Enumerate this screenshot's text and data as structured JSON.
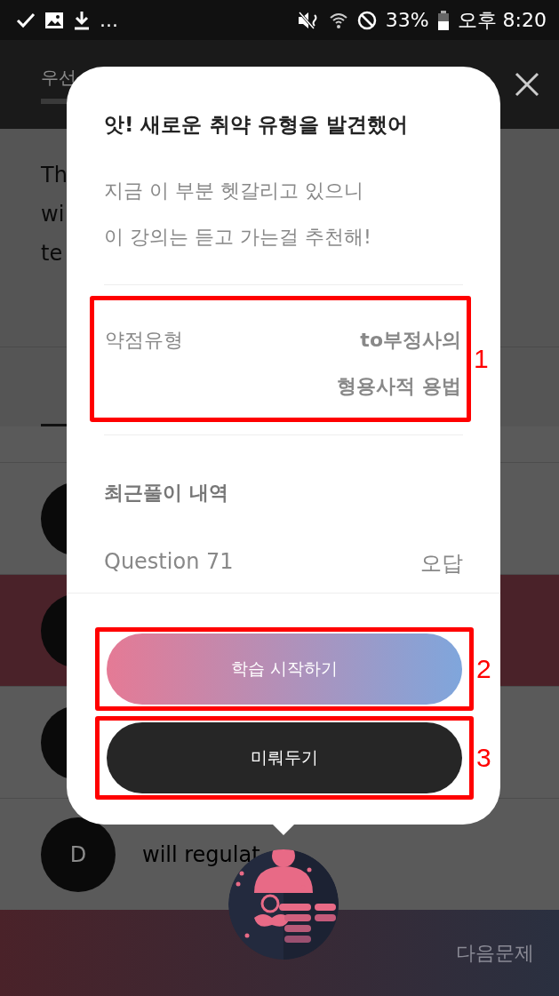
{
  "status_bar": {
    "overflow": "...",
    "battery": "33%",
    "time": "오후 8:20"
  },
  "header": {
    "tab_label": "우선"
  },
  "question_lines": [
    "Th",
    "wi",
    "te"
  ],
  "options": [
    {
      "selected": false
    },
    {
      "selected": true
    },
    {
      "selected": false
    },
    {
      "letter": "D",
      "text": "will regulat",
      "selected": false
    }
  ],
  "next_button": "다음문제",
  "dialog": {
    "title": "앗! 새로운 취약 유형을 발견했어",
    "message_lines": [
      "지금 이 부분 헷갈리고 있으니",
      "이 강의는 듣고 가는걸 추천해!"
    ],
    "weakness": {
      "label": "약점유형",
      "value_lines": [
        "to부정사의",
        "형용사적 용법"
      ],
      "annotation": "1"
    },
    "history": {
      "heading": "최근풀이 내역",
      "rows": [
        {
          "question": "Question 71",
          "result": "오답"
        }
      ]
    },
    "buttons": [
      {
        "label": "학습 시작하기",
        "kind": "primary",
        "annotation": "2"
      },
      {
        "label": "미뤄두기",
        "kind": "secondary",
        "annotation": "3"
      }
    ]
  }
}
